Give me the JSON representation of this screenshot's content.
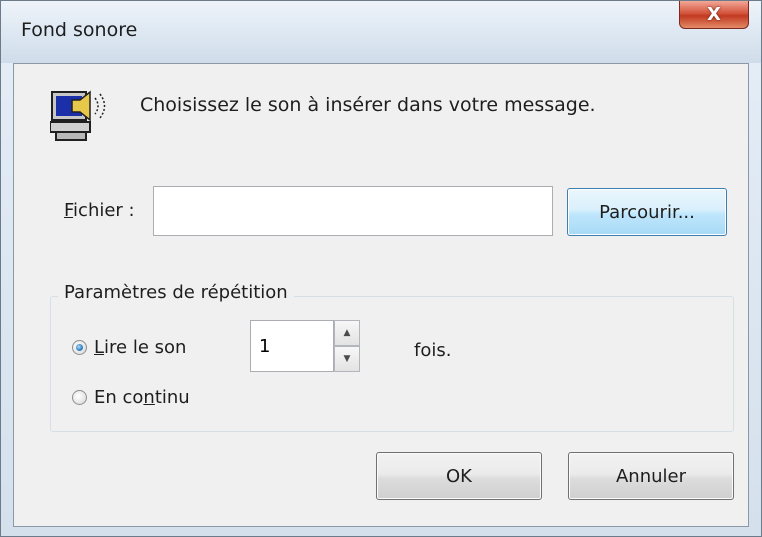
{
  "window": {
    "title": "Fond sonore",
    "close_glyph": "X"
  },
  "dialog": {
    "prompt": "Choisissez le son à insérer dans votre message.",
    "file": {
      "label_accel": "F",
      "label_rest": "ichier :",
      "value": "",
      "placeholder": ""
    },
    "browse_label": "Parcourir...",
    "repeat_group": {
      "legend": "Paramètres de répétition",
      "play_option": {
        "label_accel": "L",
        "label_rest": "ire le son",
        "checked": true
      },
      "count": "1",
      "times_label": "fois.",
      "loop_option": {
        "label_before": "En co",
        "label_accel": "n",
        "label_after": "tinu",
        "checked": false
      }
    },
    "ok_label": "OK",
    "cancel_label": "Annuler"
  },
  "icons": {
    "speaker": "speaker-computer-icon",
    "spin_up": "spin-up-arrow-icon",
    "spin_down": "spin-down-arrow-icon",
    "close": "close-icon"
  },
  "colors": {
    "close_button": "#c23a22",
    "browse_button_border": "#3c7fb1",
    "client_bg": "#f0f0f0"
  }
}
